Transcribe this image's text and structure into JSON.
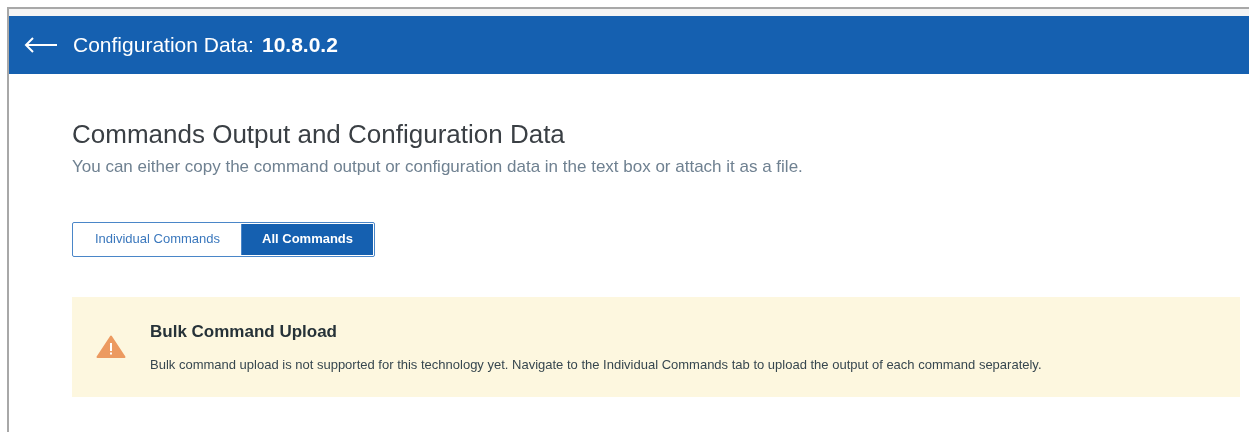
{
  "header": {
    "title": "Configuration Data:",
    "device": "10.8.0.2"
  },
  "section": {
    "heading": "Commands Output and Configuration Data",
    "description": "You can either copy the command output or configuration data in the text box or attach it as a file."
  },
  "tabs": [
    {
      "label": "Individual Commands",
      "selected": false
    },
    {
      "label": "All Commands",
      "selected": true
    }
  ],
  "alert": {
    "kind": "warning",
    "title": "Bulk Command Upload",
    "message": "Bulk command upload is not supported for this technology yet. Navigate to the Individual Commands tab to upload the output of each command separately."
  }
}
